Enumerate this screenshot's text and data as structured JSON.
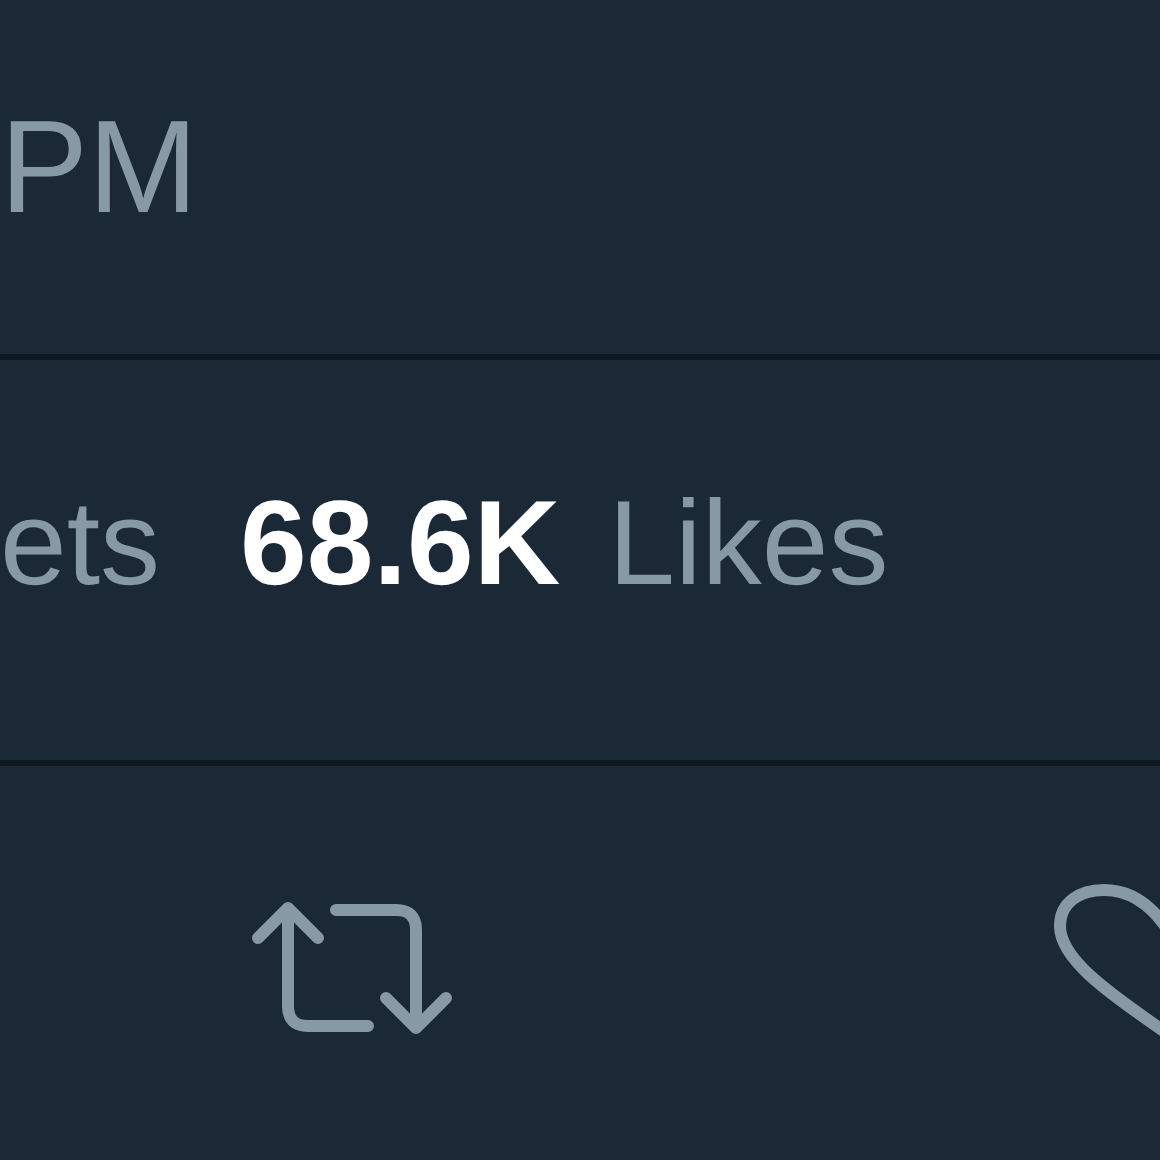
{
  "timestamp": {
    "text": "PM"
  },
  "stats": [
    {
      "label": "ets"
    },
    {
      "number": "68.6K",
      "label": "Likes"
    }
  ],
  "actions": [
    {
      "kind": "retweet"
    },
    {
      "kind": "like"
    }
  ]
}
